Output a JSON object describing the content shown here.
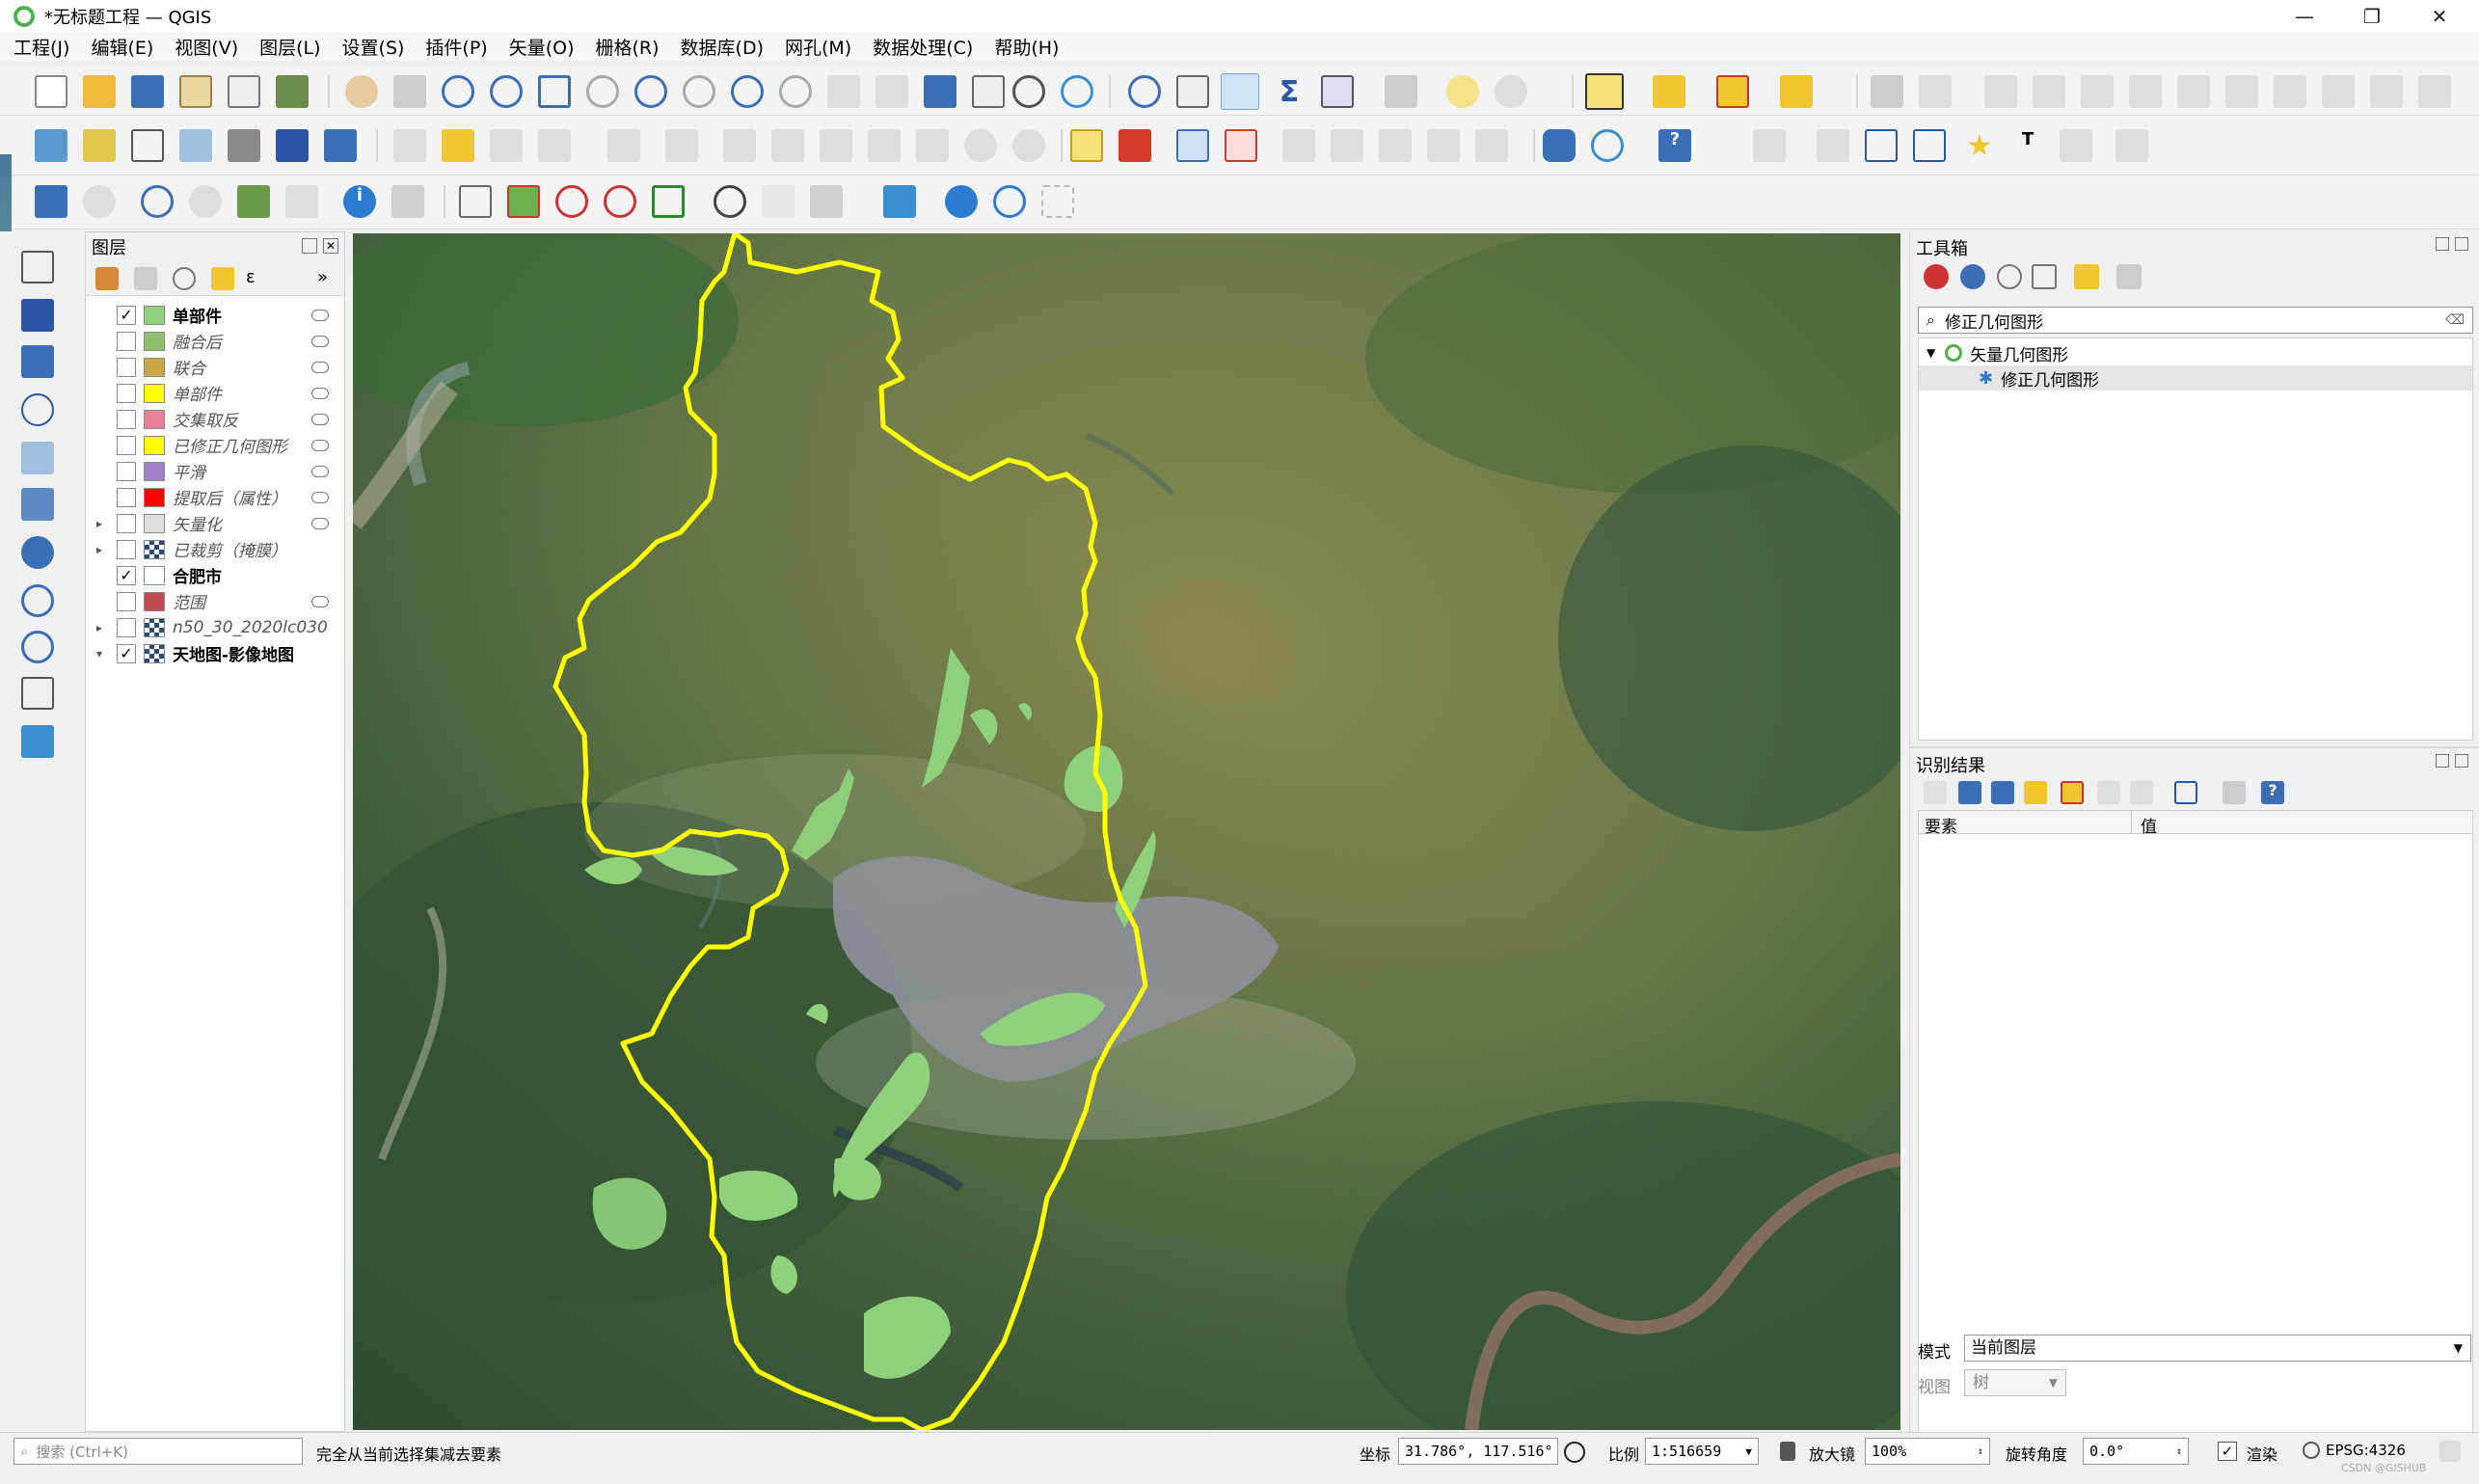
{
  "window": {
    "title": "*无标题工程 — QGIS",
    "min": "—",
    "max": "❐",
    "close": "✕"
  },
  "menu": [
    "工程(J)",
    "编辑(E)",
    "视图(V)",
    "图层(L)",
    "设置(S)",
    "插件(P)",
    "矢量(O)",
    "栅格(R)",
    "数据库(D)",
    "网孔(M)",
    "数据处理(C)",
    "帮助(H)"
  ],
  "layers_panel": {
    "title": "图层",
    "layers": [
      {
        "name": "单部件",
        "color": "#8fd17a",
        "checked": true,
        "bold": true,
        "expandable": false
      },
      {
        "name": "融合后",
        "color": "#8fbf6a",
        "checked": false,
        "bold": false,
        "expandable": false
      },
      {
        "name": "联合",
        "color": "#c9a84a",
        "checked": false,
        "bold": false,
        "expandable": false
      },
      {
        "name": "单部件",
        "color": "#ffff00",
        "checked": false,
        "bold": false,
        "expandable": false
      },
      {
        "name": "交集取反",
        "color": "#e87f9a",
        "checked": false,
        "bold": false,
        "expandable": false
      },
      {
        "name": "已修正几何图形",
        "color": "#ffff00",
        "checked": false,
        "bold": false,
        "expandable": false
      },
      {
        "name": "平滑",
        "color": "#9b80c8",
        "checked": false,
        "bold": false,
        "expandable": false
      },
      {
        "name": "提取后（属性）",
        "color": "#ff0000",
        "checked": false,
        "bold": false,
        "expandable": false
      },
      {
        "name": "矢量化",
        "color": "#dddddd",
        "checked": false,
        "bold": false,
        "expandable": true
      },
      {
        "name": "已裁剪（掩膜）",
        "color": "raster",
        "checked": false,
        "bold": false,
        "expandable": true
      },
      {
        "name": "合肥市",
        "color": "#ffffff",
        "checked": true,
        "bold": true,
        "expandable": false
      },
      {
        "name": "范围",
        "color": "#c24a55",
        "checked": false,
        "bold": false,
        "expandable": false
      },
      {
        "name": "n50_30_2020lc030",
        "color": "raster",
        "checked": false,
        "bold": false,
        "expandable": true
      },
      {
        "name": "天地图-影像地图",
        "color": "raster",
        "checked": true,
        "bold": true,
        "expandable": true,
        "expanded": true
      }
    ]
  },
  "toolbox": {
    "title": "工具箱",
    "search_value": "修正几何图形",
    "tree": [
      {
        "label": "矢量几何图形",
        "level": 0
      },
      {
        "label": "修正几何图形",
        "level": 1
      }
    ]
  },
  "identify": {
    "title": "识别结果",
    "col_feature": "要素",
    "col_value": "值",
    "mode_label": "模式",
    "mode_value": "当前图层",
    "view_label": "视图",
    "view_value": "树"
  },
  "status": {
    "search_placeholder": "搜索 (Ctrl+K)",
    "message": "完全从当前选择集减去要素",
    "coord_label": "坐标",
    "coord_value": "31.786°, 117.516°",
    "scale_label": "比例",
    "scale_value": "1:516659",
    "magnifier_label": "放大镜",
    "magnifier_value": "100%",
    "rotation_label": "旋转角度",
    "rotation_value": "0.0°",
    "render_label": "渲染",
    "crs": "EPSG:4326",
    "watermark": "CSDN @GISHUB"
  },
  "colors": {
    "boundary": "#ffff00",
    "patches": "#8fd17a",
    "lake": "#8a8f96"
  }
}
